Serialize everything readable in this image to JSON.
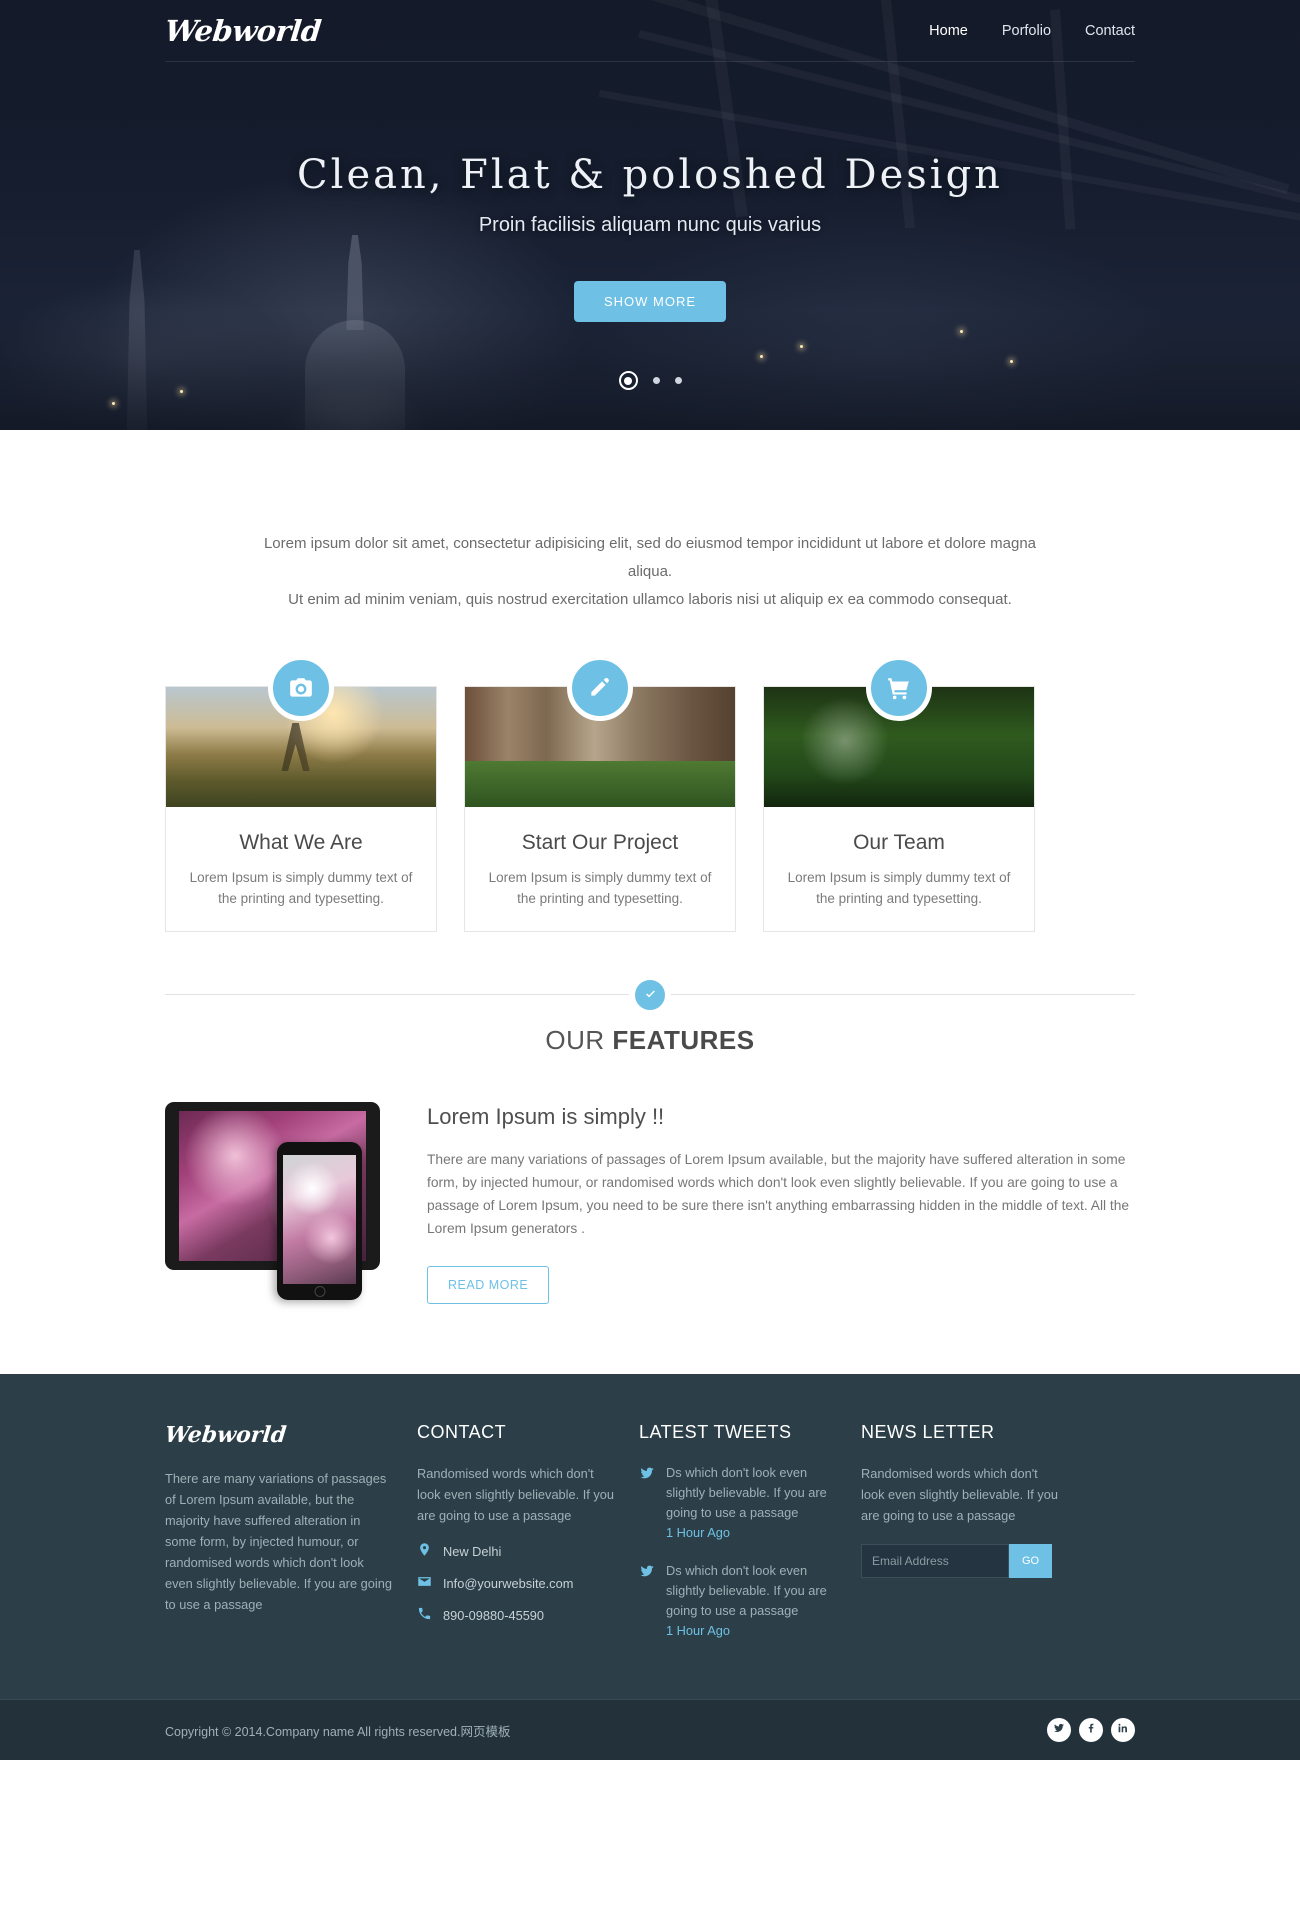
{
  "header": {
    "logo": "Webworld",
    "nav": [
      {
        "label": "Home"
      },
      {
        "label": "Porfolio"
      },
      {
        "label": "Contact"
      }
    ]
  },
  "hero": {
    "title": "Clean, Flat & poloshed Design",
    "subtitle": "Proin facilisis aliquam nunc quis varius",
    "button": "SHOW MORE",
    "slider_dots": 3,
    "active_dot": 1
  },
  "intro": {
    "line1": "Lorem ipsum dolor sit amet, consectetur adipisicing elit, sed do eiusmod tempor incididunt ut labore et dolore magna aliqua.",
    "line2": "Ut enim ad minim veniam, quis nostrud exercitation ullamco laboris nisi ut aliquip ex ea commodo consequat."
  },
  "cards": [
    {
      "icon": "camera-icon",
      "title": "What We Are",
      "desc": "Lorem Ipsum is simply dummy text of the printing and typesetting."
    },
    {
      "icon": "pencil-edit-icon",
      "title": "Start Our Project",
      "desc": "Lorem Ipsum is simply dummy text of the printing and typesetting."
    },
    {
      "icon": "shopping-cart-icon",
      "title": "Our Team",
      "desc": "Lorem Ipsum is simply dummy text of the printing and typesetting."
    }
  ],
  "features": {
    "heading_light": "OUR ",
    "heading_bold": "FEATURES",
    "badge_icon": "check-circle-icon",
    "title": "Lorem Ipsum is simply !!",
    "paragraph": "There are many variations of passages of Lorem Ipsum available, but the majority have suffered alteration in some form, by injected humour, or randomised words which don't look even slightly believable. If you are going to use a passage of Lorem Ipsum, you need to be sure there isn't anything embarrassing hidden in the middle of text. All the Lorem Ipsum generators .",
    "button": "READ MORE"
  },
  "footer": {
    "about": {
      "logo": "Webworld",
      "text": "There are many variations of passages of Lorem Ipsum available, but the majority have suffered alteration in some form, by injected humour, or randomised words which don't look even slightly believable. If you are going to use a passage"
    },
    "contact": {
      "heading": "CONTACT",
      "text": "Randomised words which don't look even slightly believable. If you are going to use a passage",
      "items": [
        {
          "icon": "map-pin-icon",
          "value": "New Delhi"
        },
        {
          "icon": "envelope-icon",
          "value": "Info@yourwebsite.com"
        },
        {
          "icon": "phone-icon",
          "value": "890-09880-45590"
        }
      ]
    },
    "tweets": {
      "heading": "LATEST TWEETS",
      "items": [
        {
          "icon": "twitter-icon",
          "text": "Ds which don't look even slightly believable. If you are going to use a passage",
          "time": "1 Hour Ago"
        },
        {
          "icon": "twitter-icon",
          "text": "Ds which don't look even slightly believable. If you are going to use a passage",
          "time": "1 Hour Ago"
        }
      ]
    },
    "newsletter": {
      "heading": "NEWS LETTER",
      "text": "Randomised words which don't look even slightly believable. If you are going to use a passage",
      "placeholder": "Email Address",
      "value": "",
      "button": "GO"
    }
  },
  "copyright": {
    "text": "Copyright © 2014.Company name All rights reserved.网页模板",
    "socials": [
      {
        "icon": "twitter-icon"
      },
      {
        "icon": "facebook-icon"
      },
      {
        "icon": "linkedin-icon"
      }
    ]
  },
  "colors": {
    "accent": "#6ec1e4",
    "hero_bg": "#151c2c",
    "footer_bg": "#2c3e47",
    "copy_bg": "#23323a"
  }
}
